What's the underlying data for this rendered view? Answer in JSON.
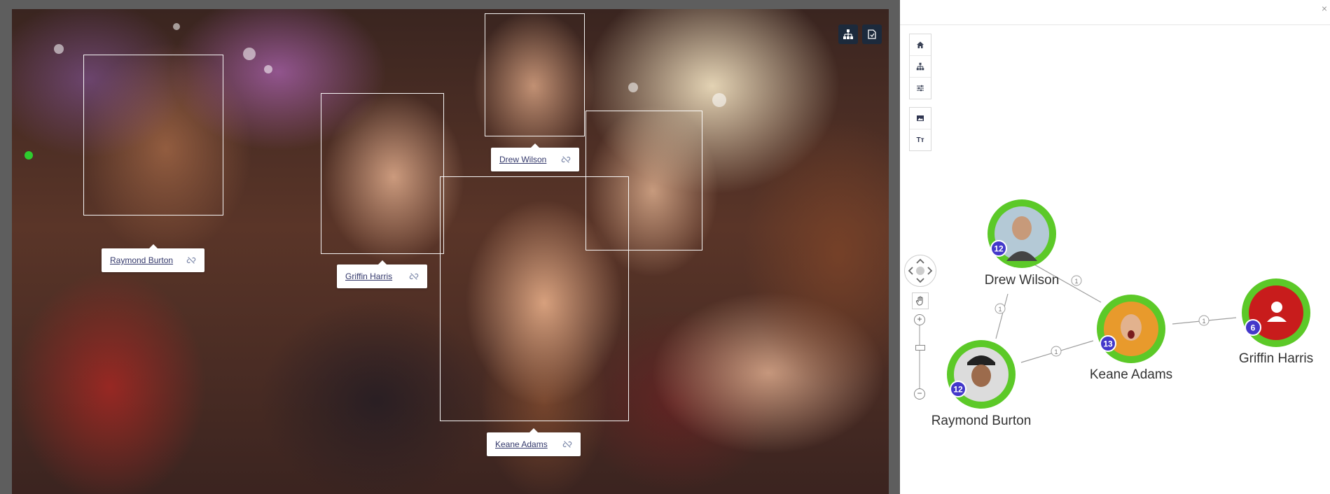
{
  "photo": {
    "faces": [
      {
        "id": "raymond",
        "name": "Raymond Burton"
      },
      {
        "id": "griffin",
        "name": "Griffin Harris"
      },
      {
        "id": "drew",
        "name": "Drew Wilson"
      },
      {
        "id": "keane",
        "name": "Keane Adams"
      },
      {
        "id": "unknown"
      }
    ],
    "tools": [
      {
        "icon": "hierarchy-icon"
      },
      {
        "icon": "export-icon"
      }
    ]
  },
  "graph": {
    "close_label": "×",
    "toolbar": [
      {
        "icon": "home-icon"
      },
      {
        "icon": "hierarchy-icon"
      },
      {
        "icon": "sliders-icon"
      }
    ],
    "toolbar2": [
      {
        "icon": "image-icon"
      },
      {
        "icon": "text-size-icon",
        "label": "Tт"
      }
    ],
    "zoom_in": "+",
    "zoom_out": "−",
    "nodes": [
      {
        "id": "drew",
        "name": "Drew Wilson",
        "badge": "12",
        "ring": "#5cc928"
      },
      {
        "id": "keane",
        "name": "Keane Adams",
        "badge": "13",
        "ring": "#5cc928"
      },
      {
        "id": "raymond",
        "name": "Raymond Burton",
        "badge": "12",
        "ring": "#5cc928"
      },
      {
        "id": "griffin",
        "name": "Griffin Harris",
        "badge": "6",
        "ring": "#5cc928",
        "fill": "#c81c1c"
      }
    ],
    "edges": [
      {
        "from": "drew",
        "to": "keane",
        "label": "1"
      },
      {
        "from": "drew",
        "to": "raymond",
        "label": "1"
      },
      {
        "from": "raymond",
        "to": "keane",
        "label": "1"
      },
      {
        "from": "keane",
        "to": "griffin",
        "label": "1"
      }
    ],
    "colors": {
      "badge": "#4338ca",
      "ring": "#5cc928",
      "edge": "#9e9e9e",
      "tool_dark": "#1c2a3c"
    }
  }
}
